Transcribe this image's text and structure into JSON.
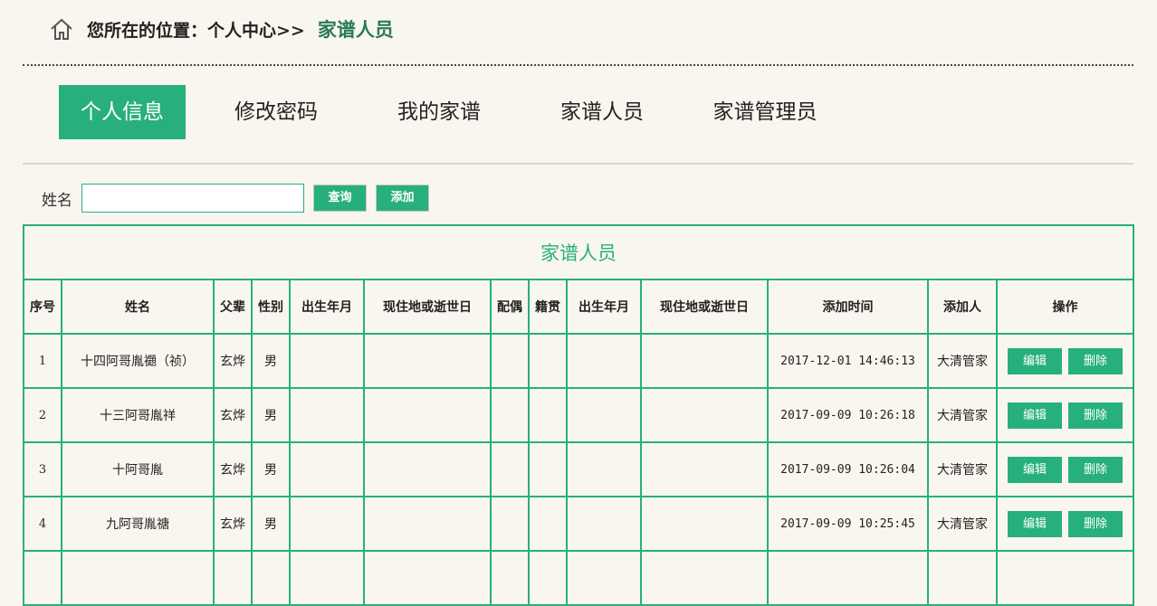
{
  "breadcrumb": {
    "prefix": "您所在的位置：个人中心>>",
    "current": "家谱人员",
    "icon": "home-icon"
  },
  "nav": {
    "items": [
      {
        "label": "个人信息",
        "active": true
      },
      {
        "label": "修改密码",
        "active": false
      },
      {
        "label": "我的家谱",
        "active": false
      },
      {
        "label": "家谱人员",
        "active": false
      },
      {
        "label": "家谱管理员",
        "active": false
      }
    ]
  },
  "search": {
    "label": "姓名",
    "value": "",
    "placeholder": "",
    "query_label": "查询",
    "add_label": "添加"
  },
  "table": {
    "caption": "家谱人员",
    "headers": [
      "序号",
      "姓名",
      "父辈",
      "性别",
      "出生年月",
      "现住地或逝世日",
      "配偶",
      "籍贯",
      "出生年月",
      "现住地或逝世日",
      "添加时间",
      "添加人",
      "操作"
    ],
    "rows": [
      {
        "seq": "1",
        "name": "十四阿哥胤禵（祯）",
        "father": "玄烨",
        "gender": "男",
        "birth": "",
        "residence": "",
        "spouse": "",
        "native": "",
        "birth2": "",
        "residence2": "",
        "time": "2017-12-01 14:46:13",
        "adder": "大清管家",
        "edit": "编辑",
        "delete": "删除"
      },
      {
        "seq": "2",
        "name": "十三阿哥胤祥",
        "father": "玄烨",
        "gender": "男",
        "birth": "",
        "residence": "",
        "spouse": "",
        "native": "",
        "birth2": "",
        "residence2": "",
        "time": "2017-09-09 10:26:18",
        "adder": "大清管家",
        "edit": "编辑",
        "delete": "删除"
      },
      {
        "seq": "3",
        "name": "十阿哥胤",
        "father": "玄烨",
        "gender": "男",
        "birth": "",
        "residence": "",
        "spouse": "",
        "native": "",
        "birth2": "",
        "residence2": "",
        "time": "2017-09-09 10:26:04",
        "adder": "大清管家",
        "edit": "编辑",
        "delete": "删除"
      },
      {
        "seq": "4",
        "name": "九阿哥胤禟",
        "father": "玄烨",
        "gender": "男",
        "birth": "",
        "residence": "",
        "spouse": "",
        "native": "",
        "birth2": "",
        "residence2": "",
        "time": "2017-09-09 10:25:45",
        "adder": "大清管家",
        "edit": "编辑",
        "delete": "删除"
      },
      {
        "seq": "",
        "name": "",
        "father": "",
        "gender": "",
        "birth": "",
        "residence": "",
        "spouse": "",
        "native": "",
        "birth2": "",
        "residence2": "",
        "time": "",
        "adder": "",
        "edit": "",
        "delete": ""
      }
    ]
  },
  "colors": {
    "accent": "#27b07d",
    "background": "#f9f6ef",
    "breadcrumb_current": "#2a7a5a"
  }
}
